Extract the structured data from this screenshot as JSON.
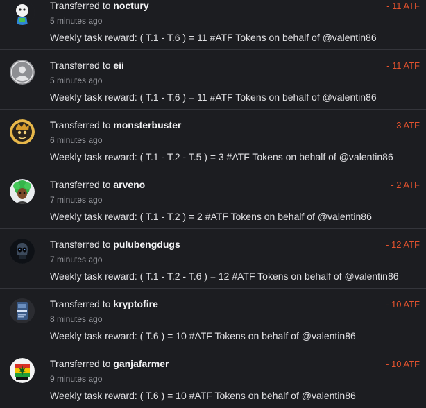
{
  "transfers": [
    {
      "prefix": "Transferred to",
      "user": "noctury",
      "time": "5 minutes ago",
      "memo": "Weekly task reward: ( T.1 - T.6 ) = 11 #ATF Tokens on behalf of @valentin86",
      "amount": "- 11 ATF",
      "avatar_icon": "cartoon-character-avatar-icon"
    },
    {
      "prefix": "Transferred to",
      "user": "eii",
      "time": "5 minutes ago",
      "memo": "Weekly task reward: ( T.1 - T.6 ) = 11 #ATF Tokens on behalf of @valentin86",
      "amount": "- 11 ATF",
      "avatar_icon": "default-user-avatar-icon"
    },
    {
      "prefix": "Transferred to",
      "user": "monsterbuster",
      "time": "6 minutes ago",
      "memo": "Weekly task reward: ( T.1 - T.2 - T.5 ) = 3 #ATF Tokens on behalf of @valentin86",
      "amount": "- 3 ATF",
      "avatar_icon": "monster-avatar-icon"
    },
    {
      "prefix": "Transferred to",
      "user": "arveno",
      "time": "7 minutes ago",
      "memo": "Weekly task reward: ( T.1 - T.2 ) = 2 #ATF Tokens on behalf of @valentin86",
      "amount": "- 2 ATF",
      "avatar_icon": "green-hair-avatar-icon"
    },
    {
      "prefix": "Transferred to",
      "user": "pulubengdugs",
      "time": "7 minutes ago",
      "memo": "Weekly task reward: ( T.1 - T.2 - T.6 ) = 12 #ATF Tokens on behalf of @valentin86",
      "amount": "- 12 ATF",
      "avatar_icon": "skull-avatar-icon"
    },
    {
      "prefix": "Transferred to",
      "user": "kryptofire",
      "time": "8 minutes ago",
      "memo": "Weekly task reward: ( T.6 ) = 10 #ATF Tokens on behalf of @valentin86",
      "amount": "- 10 ATF",
      "avatar_icon": "card-avatar-icon"
    },
    {
      "prefix": "Transferred to",
      "user": "ganjafarmer",
      "time": "9 minutes ago",
      "memo": "Weekly task reward: ( T.6 ) = 10 #ATF Tokens on behalf of @valentin86",
      "amount": "- 10 ATF",
      "avatar_icon": "leaf-flag-avatar-icon"
    }
  ],
  "colors": {
    "background": "#1c1d21",
    "divider": "#34353b",
    "amount": "#e2522e",
    "timestamp": "#9a9ba1"
  }
}
